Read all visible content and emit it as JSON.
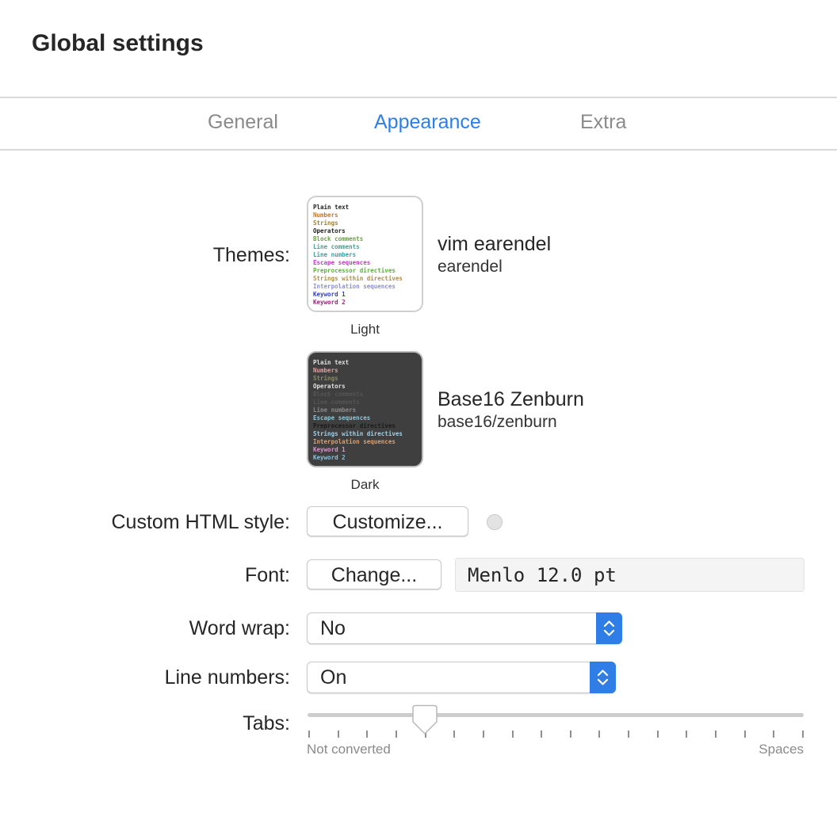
{
  "window": {
    "title": "Global settings"
  },
  "tabs": [
    {
      "label": "General",
      "active": false
    },
    {
      "label": "Appearance",
      "active": true
    },
    {
      "label": "Extra",
      "active": false
    }
  ],
  "colors": {
    "accent": "#2f7ee8",
    "dark_thumb_bg": "#3f3f3f"
  },
  "themes": {
    "label": "Themes:",
    "light": {
      "caption": "Light",
      "name": "vim earendel",
      "id": "earendel",
      "preview_lines": [
        {
          "text": "Plain text",
          "color": "#222222"
        },
        {
          "text": "Numbers",
          "color": "#c07a2a"
        },
        {
          "text": "Strings",
          "color": "#a0803a"
        },
        {
          "text": "Operators",
          "color": "#222222"
        },
        {
          "text": "Block comments",
          "color": "#6aa040"
        },
        {
          "text": "Line comments",
          "color": "#4aa090"
        },
        {
          "text": "Line numbers",
          "color": "#3aa0a0"
        },
        {
          "text": "Escape sequences",
          "color": "#c040c0"
        },
        {
          "text": "Preprocessor directives",
          "color": "#60b040"
        },
        {
          "text": "Strings within directives",
          "color": "#b09040"
        },
        {
          "text": "Interpolation sequences",
          "color": "#9090d0"
        },
        {
          "text": "Keyword 1",
          "color": "#3040c0"
        },
        {
          "text": "Keyword 2",
          "color": "#a02080"
        }
      ]
    },
    "dark": {
      "caption": "Dark",
      "name": "Base16 Zenburn",
      "id": "base16/zenburn",
      "preview_lines": [
        {
          "text": "Plain text",
          "color": "#e0e0e0"
        },
        {
          "text": "Numbers",
          "color": "#d8a0a0"
        },
        {
          "text": "Strings",
          "color": "#8a8a6a"
        },
        {
          "text": "Operators",
          "color": "#e0e0e0"
        },
        {
          "text": "Block comments",
          "color": "#555555"
        },
        {
          "text": "Line comments",
          "color": "#555555"
        },
        {
          "text": "Line numbers",
          "color": "#8a8a8a"
        },
        {
          "text": "Escape sequences",
          "color": "#8ac8d8"
        },
        {
          "text": "Preprocessor directives",
          "color": "#1a1a1a"
        },
        {
          "text": "Strings within directives",
          "color": "#a0d0e8"
        },
        {
          "text": "Interpolation sequences",
          "color": "#d8a070"
        },
        {
          "text": "Keyword 1",
          "color": "#e090d0"
        },
        {
          "text": "Keyword 2",
          "color": "#8ac0e0"
        }
      ]
    }
  },
  "custom_html": {
    "label": "Custom HTML style:",
    "button_label": "Customize...",
    "indicator_icon": "status-dot-icon"
  },
  "font": {
    "label": "Font:",
    "button_label": "Change...",
    "value": "Menlo 12.0 pt"
  },
  "word_wrap": {
    "label": "Word wrap:",
    "value": "No",
    "icon": "up-down-chevron-icon"
  },
  "line_numbers": {
    "label": "Line numbers:",
    "value": "On",
    "icon": "up-down-chevron-icon"
  },
  "tabs_setting": {
    "label": "Tabs:",
    "min_label": "Not converted",
    "max_label": "Spaces",
    "tick_count": 18,
    "selected_index": 4
  }
}
